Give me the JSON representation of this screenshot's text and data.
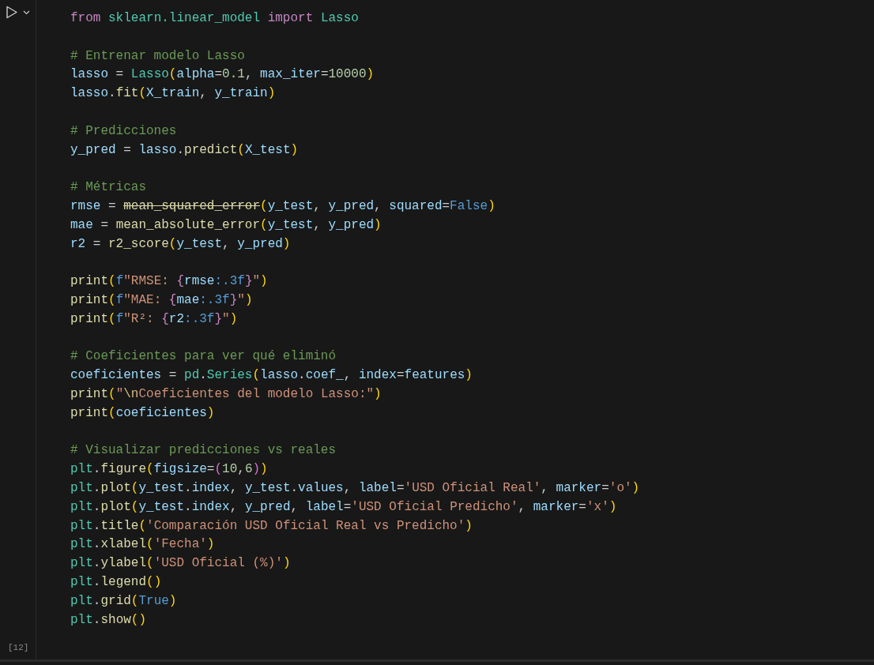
{
  "cell": {
    "execution_count": "[12]",
    "lines": [
      {
        "kind": "code",
        "tokens": [
          {
            "text": "from ",
            "kind": "keyword"
          },
          {
            "text": "sklearn.linear_model ",
            "kind": "type"
          },
          {
            "text": "import ",
            "kind": "keyword"
          },
          {
            "text": "Lasso",
            "kind": "type"
          }
        ]
      },
      {
        "kind": "blank"
      },
      {
        "kind": "code",
        "tokens": [
          {
            "text": "# Entrenar modelo Lasso",
            "kind": "comment"
          }
        ]
      },
      {
        "kind": "code",
        "tokens": [
          {
            "text": "lasso",
            "kind": "variable"
          },
          {
            "text": " = ",
            "kind": "plain"
          },
          {
            "text": "Lasso",
            "kind": "type"
          },
          {
            "text": "(",
            "kind": "bracket1"
          },
          {
            "text": "alpha",
            "kind": "variable"
          },
          {
            "text": "=",
            "kind": "plain"
          },
          {
            "text": "0.1",
            "kind": "number"
          },
          {
            "text": ", ",
            "kind": "plain"
          },
          {
            "text": "max_iter",
            "kind": "variable"
          },
          {
            "text": "=",
            "kind": "plain"
          },
          {
            "text": "10000",
            "kind": "number"
          },
          {
            "text": ")",
            "kind": "bracket1"
          }
        ]
      },
      {
        "kind": "code",
        "tokens": [
          {
            "text": "lasso",
            "kind": "variable"
          },
          {
            "text": ".",
            "kind": "plain"
          },
          {
            "text": "fit",
            "kind": "function"
          },
          {
            "text": "(",
            "kind": "bracket1"
          },
          {
            "text": "X_train",
            "kind": "variable"
          },
          {
            "text": ", ",
            "kind": "plain"
          },
          {
            "text": "y_train",
            "kind": "variable"
          },
          {
            "text": ")",
            "kind": "bracket1"
          }
        ]
      },
      {
        "kind": "blank"
      },
      {
        "kind": "code",
        "tokens": [
          {
            "text": "# Predicciones",
            "kind": "comment"
          }
        ]
      },
      {
        "kind": "code",
        "tokens": [
          {
            "text": "y_pred",
            "kind": "variable"
          },
          {
            "text": " = ",
            "kind": "plain"
          },
          {
            "text": "lasso",
            "kind": "variable"
          },
          {
            "text": ".",
            "kind": "plain"
          },
          {
            "text": "predict",
            "kind": "function"
          },
          {
            "text": "(",
            "kind": "bracket1"
          },
          {
            "text": "X_test",
            "kind": "variable"
          },
          {
            "text": ")",
            "kind": "bracket1"
          }
        ]
      },
      {
        "kind": "blank"
      },
      {
        "kind": "code",
        "tokens": [
          {
            "text": "# Métricas",
            "kind": "comment"
          }
        ]
      },
      {
        "kind": "code",
        "tokens": [
          {
            "text": "rmse",
            "kind": "variable"
          },
          {
            "text": " = ",
            "kind": "plain"
          },
          {
            "text": "mean_squared_error",
            "kind": "deprecated"
          },
          {
            "text": "(",
            "kind": "bracket1"
          },
          {
            "text": "y_test",
            "kind": "variable"
          },
          {
            "text": ", ",
            "kind": "plain"
          },
          {
            "text": "y_pred",
            "kind": "variable"
          },
          {
            "text": ", ",
            "kind": "plain"
          },
          {
            "text": "squared",
            "kind": "variable"
          },
          {
            "text": "=",
            "kind": "plain"
          },
          {
            "text": "False",
            "kind": "constant"
          },
          {
            "text": ")",
            "kind": "bracket1"
          }
        ]
      },
      {
        "kind": "code",
        "tokens": [
          {
            "text": "mae",
            "kind": "variable"
          },
          {
            "text": " = ",
            "kind": "plain"
          },
          {
            "text": "mean_absolute_error",
            "kind": "function"
          },
          {
            "text": "(",
            "kind": "bracket1"
          },
          {
            "text": "y_test",
            "kind": "variable"
          },
          {
            "text": ", ",
            "kind": "plain"
          },
          {
            "text": "y_pred",
            "kind": "variable"
          },
          {
            "text": ")",
            "kind": "bracket1"
          }
        ]
      },
      {
        "kind": "code",
        "tokens": [
          {
            "text": "r2",
            "kind": "variable"
          },
          {
            "text": " = ",
            "kind": "plain"
          },
          {
            "text": "r2_score",
            "kind": "function"
          },
          {
            "text": "(",
            "kind": "bracket1"
          },
          {
            "text": "y_test",
            "kind": "variable"
          },
          {
            "text": ", ",
            "kind": "plain"
          },
          {
            "text": "y_pred",
            "kind": "variable"
          },
          {
            "text": ")",
            "kind": "bracket1"
          }
        ]
      },
      {
        "kind": "blank"
      },
      {
        "kind": "code",
        "tokens": [
          {
            "text": "print",
            "kind": "function"
          },
          {
            "text": "(",
            "kind": "bracket1"
          },
          {
            "text": "f",
            "kind": "constant"
          },
          {
            "text": "\"RMSE: ",
            "kind": "string"
          },
          {
            "text": "{",
            "kind": "brace"
          },
          {
            "text": "rmse",
            "kind": "variable"
          },
          {
            "text": ":.3f",
            "kind": "constant"
          },
          {
            "text": "}",
            "kind": "brace"
          },
          {
            "text": "\"",
            "kind": "string"
          },
          {
            "text": ")",
            "kind": "bracket1"
          }
        ]
      },
      {
        "kind": "code",
        "tokens": [
          {
            "text": "print",
            "kind": "function"
          },
          {
            "text": "(",
            "kind": "bracket1"
          },
          {
            "text": "f",
            "kind": "constant"
          },
          {
            "text": "\"MAE: ",
            "kind": "string"
          },
          {
            "text": "{",
            "kind": "brace"
          },
          {
            "text": "mae",
            "kind": "variable"
          },
          {
            "text": ":.3f",
            "kind": "constant"
          },
          {
            "text": "}",
            "kind": "brace"
          },
          {
            "text": "\"",
            "kind": "string"
          },
          {
            "text": ")",
            "kind": "bracket1"
          }
        ]
      },
      {
        "kind": "code",
        "tokens": [
          {
            "text": "print",
            "kind": "function"
          },
          {
            "text": "(",
            "kind": "bracket1"
          },
          {
            "text": "f",
            "kind": "constant"
          },
          {
            "text": "\"R²: ",
            "kind": "string"
          },
          {
            "text": "{",
            "kind": "brace"
          },
          {
            "text": "r2",
            "kind": "variable"
          },
          {
            "text": ":.3f",
            "kind": "constant"
          },
          {
            "text": "}",
            "kind": "brace"
          },
          {
            "text": "\"",
            "kind": "string"
          },
          {
            "text": ")",
            "kind": "bracket1"
          }
        ]
      },
      {
        "kind": "blank"
      },
      {
        "kind": "code",
        "tokens": [
          {
            "text": "# Coeficientes para ver qué eliminó",
            "kind": "comment"
          }
        ]
      },
      {
        "kind": "code",
        "tokens": [
          {
            "text": "coeficientes",
            "kind": "variable"
          },
          {
            "text": " = ",
            "kind": "plain"
          },
          {
            "text": "pd",
            "kind": "type"
          },
          {
            "text": ".",
            "kind": "plain"
          },
          {
            "text": "Series",
            "kind": "type"
          },
          {
            "text": "(",
            "kind": "bracket1"
          },
          {
            "text": "lasso",
            "kind": "variable"
          },
          {
            "text": ".",
            "kind": "plain"
          },
          {
            "text": "coef_",
            "kind": "variable"
          },
          {
            "text": ", ",
            "kind": "plain"
          },
          {
            "text": "index",
            "kind": "variable"
          },
          {
            "text": "=",
            "kind": "plain"
          },
          {
            "text": "features",
            "kind": "variable"
          },
          {
            "text": ")",
            "kind": "bracket1"
          }
        ]
      },
      {
        "kind": "code",
        "tokens": [
          {
            "text": "print",
            "kind": "function"
          },
          {
            "text": "(",
            "kind": "bracket1"
          },
          {
            "text": "\"",
            "kind": "string"
          },
          {
            "text": "\\n",
            "kind": "escape"
          },
          {
            "text": "Coeficientes del modelo Lasso:\"",
            "kind": "string"
          },
          {
            "text": ")",
            "kind": "bracket1"
          }
        ]
      },
      {
        "kind": "code",
        "tokens": [
          {
            "text": "print",
            "kind": "function"
          },
          {
            "text": "(",
            "kind": "bracket1"
          },
          {
            "text": "coeficientes",
            "kind": "variable"
          },
          {
            "text": ")",
            "kind": "bracket1"
          }
        ]
      },
      {
        "kind": "blank"
      },
      {
        "kind": "code",
        "tokens": [
          {
            "text": "# Visualizar predicciones vs reales",
            "kind": "comment"
          }
        ]
      },
      {
        "kind": "code",
        "tokens": [
          {
            "text": "plt",
            "kind": "type"
          },
          {
            "text": ".",
            "kind": "plain"
          },
          {
            "text": "figure",
            "kind": "function"
          },
          {
            "text": "(",
            "kind": "bracket1"
          },
          {
            "text": "figsize",
            "kind": "variable"
          },
          {
            "text": "=",
            "kind": "plain"
          },
          {
            "text": "(",
            "kind": "bracket2"
          },
          {
            "text": "10",
            "kind": "number"
          },
          {
            "text": ",",
            "kind": "plain"
          },
          {
            "text": "6",
            "kind": "number"
          },
          {
            "text": ")",
            "kind": "bracket2"
          },
          {
            "text": ")",
            "kind": "bracket1"
          }
        ]
      },
      {
        "kind": "code",
        "tokens": [
          {
            "text": "plt",
            "kind": "type"
          },
          {
            "text": ".",
            "kind": "plain"
          },
          {
            "text": "plot",
            "kind": "function"
          },
          {
            "text": "(",
            "kind": "bracket1"
          },
          {
            "text": "y_test",
            "kind": "variable"
          },
          {
            "text": ".",
            "kind": "plain"
          },
          {
            "text": "index",
            "kind": "variable"
          },
          {
            "text": ", ",
            "kind": "plain"
          },
          {
            "text": "y_test",
            "kind": "variable"
          },
          {
            "text": ".",
            "kind": "plain"
          },
          {
            "text": "values",
            "kind": "variable"
          },
          {
            "text": ", ",
            "kind": "plain"
          },
          {
            "text": "label",
            "kind": "variable"
          },
          {
            "text": "=",
            "kind": "plain"
          },
          {
            "text": "'USD Oficial Real'",
            "kind": "string"
          },
          {
            "text": ", ",
            "kind": "plain"
          },
          {
            "text": "marker",
            "kind": "variable"
          },
          {
            "text": "=",
            "kind": "plain"
          },
          {
            "text": "'o'",
            "kind": "string"
          },
          {
            "text": ")",
            "kind": "bracket1"
          }
        ]
      },
      {
        "kind": "code",
        "tokens": [
          {
            "text": "plt",
            "kind": "type"
          },
          {
            "text": ".",
            "kind": "plain"
          },
          {
            "text": "plot",
            "kind": "function"
          },
          {
            "text": "(",
            "kind": "bracket1"
          },
          {
            "text": "y_test",
            "kind": "variable"
          },
          {
            "text": ".",
            "kind": "plain"
          },
          {
            "text": "index",
            "kind": "variable"
          },
          {
            "text": ", ",
            "kind": "plain"
          },
          {
            "text": "y_pred",
            "kind": "variable"
          },
          {
            "text": ", ",
            "kind": "plain"
          },
          {
            "text": "label",
            "kind": "variable"
          },
          {
            "text": "=",
            "kind": "plain"
          },
          {
            "text": "'USD Oficial Predicho'",
            "kind": "string"
          },
          {
            "text": ", ",
            "kind": "plain"
          },
          {
            "text": "marker",
            "kind": "variable"
          },
          {
            "text": "=",
            "kind": "plain"
          },
          {
            "text": "'x'",
            "kind": "string"
          },
          {
            "text": ")",
            "kind": "bracket1"
          }
        ]
      },
      {
        "kind": "code",
        "tokens": [
          {
            "text": "plt",
            "kind": "type"
          },
          {
            "text": ".",
            "kind": "plain"
          },
          {
            "text": "title",
            "kind": "function"
          },
          {
            "text": "(",
            "kind": "bracket1"
          },
          {
            "text": "'Comparación USD Oficial Real vs Predicho'",
            "kind": "string"
          },
          {
            "text": ")",
            "kind": "bracket1"
          }
        ]
      },
      {
        "kind": "code",
        "tokens": [
          {
            "text": "plt",
            "kind": "type"
          },
          {
            "text": ".",
            "kind": "plain"
          },
          {
            "text": "xlabel",
            "kind": "function"
          },
          {
            "text": "(",
            "kind": "bracket1"
          },
          {
            "text": "'Fecha'",
            "kind": "string"
          },
          {
            "text": ")",
            "kind": "bracket1"
          }
        ]
      },
      {
        "kind": "code",
        "tokens": [
          {
            "text": "plt",
            "kind": "type"
          },
          {
            "text": ".",
            "kind": "plain"
          },
          {
            "text": "ylabel",
            "kind": "function"
          },
          {
            "text": "(",
            "kind": "bracket1"
          },
          {
            "text": "'USD Oficial (%)'",
            "kind": "string"
          },
          {
            "text": ")",
            "kind": "bracket1"
          }
        ]
      },
      {
        "kind": "code",
        "tokens": [
          {
            "text": "plt",
            "kind": "type"
          },
          {
            "text": ".",
            "kind": "plain"
          },
          {
            "text": "legend",
            "kind": "function"
          },
          {
            "text": "()",
            "kind": "bracket1"
          }
        ]
      },
      {
        "kind": "code",
        "tokens": [
          {
            "text": "plt",
            "kind": "type"
          },
          {
            "text": ".",
            "kind": "plain"
          },
          {
            "text": "grid",
            "kind": "function"
          },
          {
            "text": "(",
            "kind": "bracket1"
          },
          {
            "text": "True",
            "kind": "constant"
          },
          {
            "text": ")",
            "kind": "bracket1"
          }
        ]
      },
      {
        "kind": "code",
        "tokens": [
          {
            "text": "plt",
            "kind": "type"
          },
          {
            "text": ".",
            "kind": "plain"
          },
          {
            "text": "show",
            "kind": "function"
          },
          {
            "text": "()",
            "kind": "bracket1"
          }
        ]
      }
    ]
  }
}
